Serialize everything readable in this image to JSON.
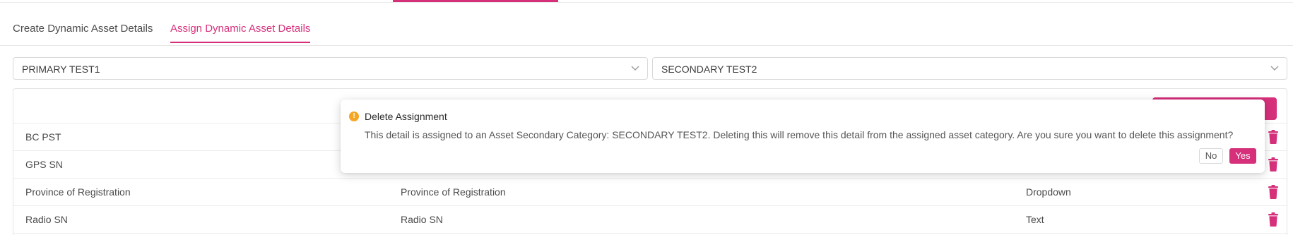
{
  "tabs": [
    {
      "label": "Create Dynamic Asset Details",
      "active": false
    },
    {
      "label": "Assign Dynamic Asset Details",
      "active": true
    }
  ],
  "filters": {
    "primary_category": "PRIMARY TEST1",
    "secondary_category": "SECONDARY TEST2"
  },
  "table": {
    "rows": [
      {
        "name": "BC PST",
        "label": "",
        "type": ""
      },
      {
        "name": "GPS SN",
        "label": "",
        "type": ""
      },
      {
        "name": "Province of Registration",
        "label": "Province of Registration",
        "type": "Dropdown"
      },
      {
        "name": "Radio SN",
        "label": "Radio SN",
        "type": "Text"
      }
    ]
  },
  "popconfirm": {
    "title": "Delete Assignment",
    "message": "This detail is assigned to an Asset Secondary Category: SECONDARY TEST2. Deleting this will remove this detail from the assigned asset category. Are you sure you want to delete this assignment?",
    "no_label": "No",
    "yes_label": "Yes",
    "icon": "exclamation-circle-icon"
  },
  "colors": {
    "accent": "#d6307b",
    "warning": "#f5a623"
  }
}
